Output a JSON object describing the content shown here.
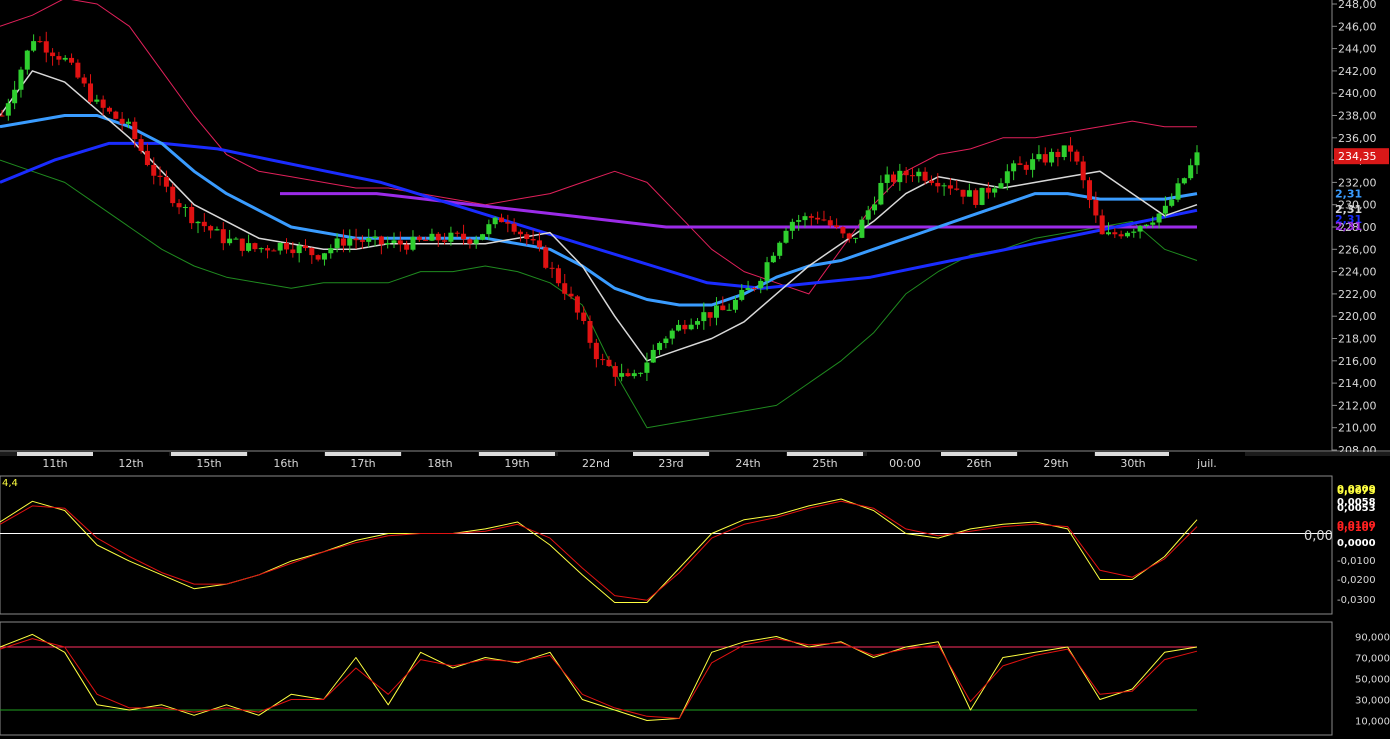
{
  "colors": {
    "background": "#000000",
    "panel_border": "#8a8a8a",
    "axis_text": "#d8d8d8",
    "candle_up": "#2fcf2f",
    "candle_down": "#e01212",
    "bollinger_upper": "#e0205a",
    "bollinger_lower": "#1f8a1f",
    "ma_fast": "#d8d8d8",
    "ma_medium": "#3a9cff",
    "ma_long": "#1a2cff",
    "ma_slow": "#9b2be8",
    "oscillator_main": "#ffff40",
    "oscillator_signal": "#e01212",
    "last_price_bg": "#d81818",
    "overbought_line": "#ff3060",
    "oversold_line": "#20a020"
  },
  "chart_data": [
    {
      "type": "candlestick",
      "panel": "price",
      "ylim": [
        208,
        248
      ],
      "y_ticks": [
        "208,00",
        "210,00",
        "212,00",
        "214,00",
        "216,00",
        "218,00",
        "220,00",
        "222,00",
        "224,00",
        "226,00",
        "228,00",
        "230,00",
        "232,00",
        "234,00",
        "236,00",
        "238,00",
        "240,00",
        "242,00",
        "244,00",
        "246,00",
        "248,00"
      ],
      "x_labels": [
        "11th",
        "12th",
        "15th",
        "16th",
        "17th",
        "18th",
        "19th",
        "22nd",
        "23rd",
        "24th",
        "25th",
        "00:00",
        "26th",
        "29th",
        "30th",
        "juil."
      ],
      "last_price_label": "234,35",
      "overlay_value_labels": [
        "2,31",
        "2,31",
        "2,31",
        "2,31"
      ],
      "series": [
        {
          "name": "Bollinger upper",
          "values": [
            246,
            247,
            248.5,
            248,
            246,
            242,
            238,
            234.5,
            233,
            232.5,
            232,
            231.5,
            231.5,
            231,
            230.5,
            230,
            230.5,
            231,
            232,
            233,
            232,
            229,
            226,
            224,
            223,
            222,
            226,
            230,
            233,
            234.5,
            235,
            236,
            236,
            236.5,
            237,
            237.5,
            237,
            237
          ]
        },
        {
          "name": "Bollinger lower",
          "values": [
            234,
            233,
            232,
            230,
            228,
            226,
            224.5,
            223.5,
            223,
            222.5,
            223,
            223,
            223,
            224,
            224,
            224.5,
            224,
            223,
            221,
            215,
            210,
            210.5,
            211,
            211.5,
            212,
            214,
            216,
            218.5,
            222,
            224,
            225.5,
            226,
            227,
            227.5,
            228,
            228.5,
            226,
            225
          ]
        },
        {
          "name": "MA fast",
          "values": [
            238,
            242,
            241,
            238.5,
            236,
            233,
            230,
            228.5,
            227,
            226.5,
            226,
            226,
            226.5,
            226.5,
            226.5,
            226.5,
            227,
            227.5,
            224.5,
            220,
            216,
            217,
            218,
            219.5,
            222,
            224.5,
            226.5,
            228.5,
            231,
            232.5,
            232,
            231.5,
            232,
            232.5,
            233,
            231,
            229,
            230
          ]
        },
        {
          "name": "MA medium",
          "values": [
            237,
            237.5,
            238,
            238,
            237,
            235.5,
            233,
            231,
            229.5,
            228,
            227.5,
            227,
            227,
            227,
            227,
            227,
            226.5,
            226,
            224.5,
            222.5,
            221.5,
            221,
            221,
            222,
            223.5,
            224.5,
            225,
            226,
            227,
            228,
            229,
            230,
            231,
            231,
            230.5,
            230.5,
            230.5,
            231
          ]
        },
        {
          "name": "MA long",
          "values": [
            232,
            234,
            235.5,
            235.5,
            235,
            234,
            233,
            232,
            230.5,
            229,
            227.5,
            226,
            224.5,
            223,
            222.5,
            223,
            223.5,
            224.5,
            225.5,
            226.5,
            227.5,
            228.5,
            229.5
          ]
        },
        {
          "name": "MA slow",
          "values": [
            231,
            231,
            231,
            230.5,
            230,
            229.5,
            229,
            228.5,
            228,
            228,
            228,
            228,
            228,
            228,
            228,
            228,
            228,
            228,
            228,
            228
          ]
        },
        {
          "name": "Price",
          "values": [
            238,
            245,
            243,
            239,
            237,
            232,
            229,
            227,
            226,
            226.5,
            225.5,
            227,
            226.5,
            226.5,
            227,
            227,
            229,
            226,
            222,
            216,
            214,
            218,
            220,
            220.5,
            223,
            228.5,
            229,
            226.5,
            232,
            233,
            232,
            230.5,
            233,
            234,
            235,
            227,
            228,
            229.5,
            234.35
          ]
        }
      ]
    },
    {
      "type": "line",
      "panel": "oscillator",
      "title": "4,4",
      "ylim": [
        -0.035,
        0.025
      ],
      "y_ticks": [
        "0,0200",
        "0,0075",
        "0,0058",
        "0,0053",
        "0,0100",
        "0,0107",
        "0,0000",
        "-0,0100",
        "-0,0200",
        "-0,0300"
      ],
      "zero_label": "0,00",
      "series": [
        {
          "name": "main",
          "values": [
            0.005,
            0.014,
            0.01,
            -0.005,
            -0.012,
            -0.018,
            -0.024,
            -0.022,
            -0.018,
            -0.012,
            -0.008,
            -0.003,
            0.0,
            0.0,
            0.0,
            0.002,
            0.005,
            -0.005,
            -0.018,
            -0.03,
            -0.03,
            -0.015,
            0.0,
            0.006,
            0.008,
            0.012,
            0.015,
            0.01,
            0.0,
            -0.002,
            0.002,
            0.004,
            0.005,
            0.002,
            -0.02,
            -0.02,
            -0.01,
            0.006
          ]
        },
        {
          "name": "signal",
          "values": [
            0.004,
            0.012,
            0.011,
            -0.002,
            -0.01,
            -0.017,
            -0.022,
            -0.022,
            -0.018,
            -0.013,
            -0.008,
            -0.004,
            -0.001,
            0.0,
            0.0,
            0.001,
            0.004,
            -0.002,
            -0.015,
            -0.027,
            -0.029,
            -0.017,
            -0.002,
            0.004,
            0.007,
            0.011,
            0.014,
            0.011,
            0.002,
            -0.001,
            0.001,
            0.003,
            0.004,
            0.003,
            -0.016,
            -0.019,
            -0.011,
            0.003
          ]
        }
      ]
    },
    {
      "type": "line",
      "panel": "stochastic",
      "ylim": [
        0,
        100
      ],
      "y_ticks": [
        "90,0000",
        "70,0000",
        "50,0000",
        "30,0000",
        "10,0000"
      ],
      "overbought": 80,
      "oversold": 20,
      "series": [
        {
          "name": "main",
          "values": [
            80,
            92,
            75,
            25,
            20,
            25,
            15,
            25,
            15,
            35,
            30,
            70,
            25,
            75,
            60,
            70,
            65,
            75,
            30,
            20,
            10,
            12,
            75,
            85,
            90,
            80,
            85,
            70,
            80,
            85,
            20,
            70,
            75,
            80,
            30,
            40,
            75,
            80
          ]
        },
        {
          "name": "signal",
          "values": [
            78,
            88,
            80,
            35,
            22,
            22,
            18,
            22,
            18,
            30,
            30,
            60,
            35,
            68,
            62,
            68,
            66,
            72,
            35,
            22,
            14,
            12,
            65,
            82,
            88,
            82,
            84,
            72,
            78,
            82,
            28,
            62,
            72,
            78,
            35,
            38,
            68,
            76
          ]
        }
      ]
    }
  ]
}
